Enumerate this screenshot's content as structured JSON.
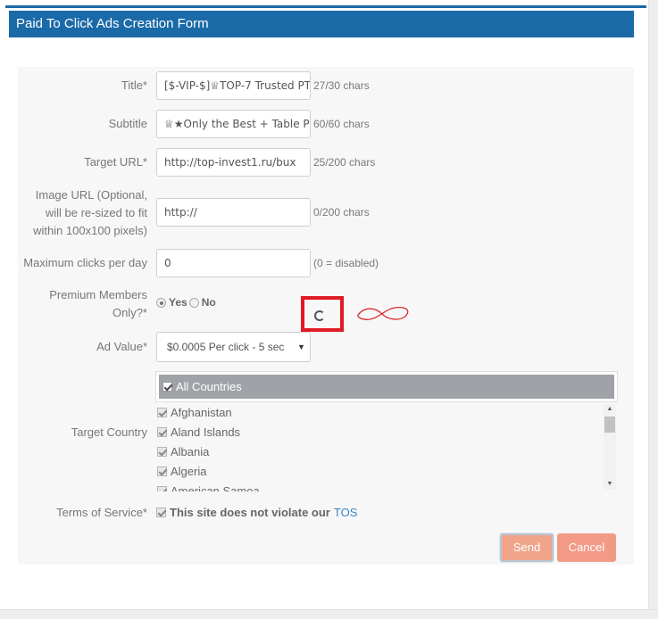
{
  "form": {
    "heading": "Paid To Click Ads Creation Form",
    "title": {
      "label": "Title*",
      "value": "[$-VIP-$]♕TOP-7 Trusted PT",
      "counter": "27/30 chars"
    },
    "subtitle": {
      "label": "Subtitle",
      "value": "♕★Only the Best + Table Pro",
      "counter": "60/60 chars"
    },
    "target_url": {
      "label": "Target URL*",
      "value": "http://top-invest1.ru/bux",
      "counter": "25/200 chars"
    },
    "image_url": {
      "label_line1": "Image URL (Optional,",
      "label_line2": "will be re-sized to fit",
      "label_line3": "within 100x100 pixels)",
      "value": "http://",
      "counter": "0/200 chars"
    },
    "max_clicks": {
      "label": "Maximum clicks per day",
      "value": "0",
      "counter": "(0 = disabled)"
    },
    "premium": {
      "label_line1": "Premium Members",
      "label_line2": "Only?*",
      "yes": "Yes",
      "no": "No"
    },
    "ad_value": {
      "label": "Ad Value*",
      "selected": "$0.0005 Per click - 5 sec"
    },
    "target_country": {
      "label": "Target Country",
      "all": "All Countries",
      "countries": [
        "Afghanistan",
        "Aland Islands",
        "Albania",
        "Algeria",
        "American Samoa"
      ]
    },
    "tos": {
      "label": "Terms of Service*",
      "text": "This site does not violate our",
      "link": "TOS"
    },
    "buttons": {
      "send": "Send",
      "cancel": "Cancel"
    }
  },
  "colors": {
    "header": "#1b6aa8",
    "send": "#f0a58a",
    "cancel": "#f29a86",
    "link": "#3a87c8",
    "annotation": "#e01b24"
  }
}
